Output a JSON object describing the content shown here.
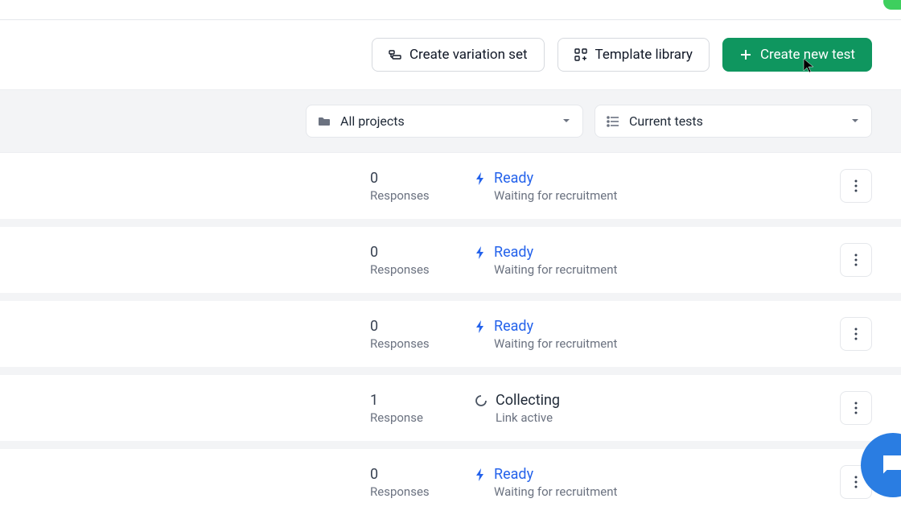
{
  "actions": {
    "variation_label": "Create variation set",
    "template_label": "Template library",
    "create_label": "Create new test"
  },
  "filters": {
    "projects": "All projects",
    "view": "Current tests"
  },
  "rows": [
    {
      "count": "0",
      "count_label": "Responses",
      "status": "Ready",
      "sub": "Waiting for recruitment",
      "kind": "ready"
    },
    {
      "count": "0",
      "count_label": "Responses",
      "status": "Ready",
      "sub": "Waiting for recruitment",
      "kind": "ready"
    },
    {
      "count": "0",
      "count_label": "Responses",
      "status": "Ready",
      "sub": "Waiting for recruitment",
      "kind": "ready"
    },
    {
      "count": "1",
      "count_label": "Response",
      "status": "Collecting",
      "sub": "Link active",
      "kind": "collecting"
    },
    {
      "count": "0",
      "count_label": "Responses",
      "status": "Ready",
      "sub": "Waiting for recruitment",
      "kind": "ready"
    }
  ]
}
